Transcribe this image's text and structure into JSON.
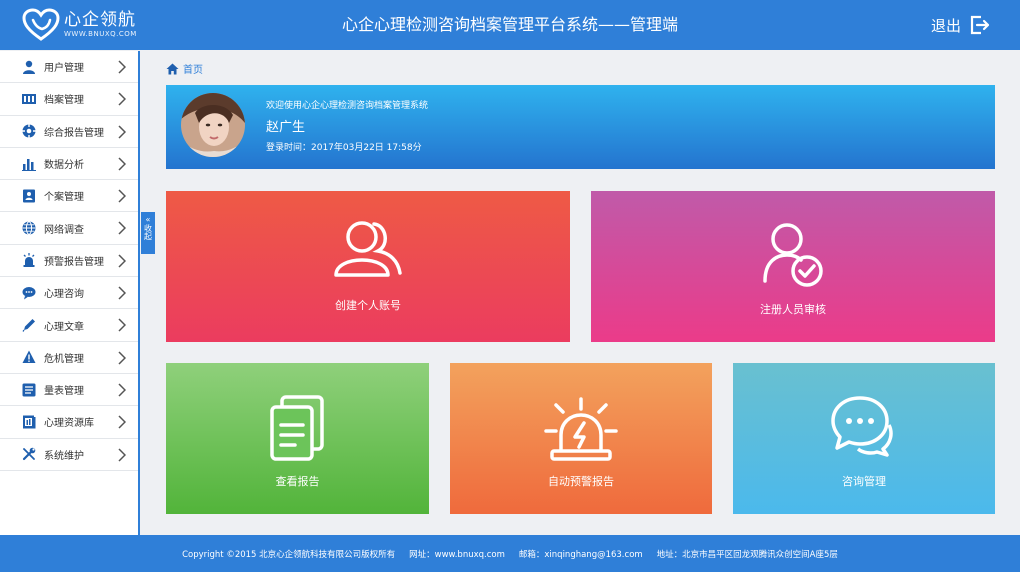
{
  "header": {
    "brand_name": "心企领航",
    "brand_url": "WWW.BNUXQ.COM",
    "title": "心企心理检测咨询档案管理平台系统——管理端",
    "logout_label": "退出"
  },
  "sidebar": {
    "items": [
      {
        "label": "用户管理",
        "icon": "user-icon"
      },
      {
        "label": "档案管理",
        "icon": "archive-icon"
      },
      {
        "label": "综合报告管理",
        "icon": "compass-icon"
      },
      {
        "label": "数据分析",
        "icon": "bar-chart-icon"
      },
      {
        "label": "个案管理",
        "icon": "contact-card-icon"
      },
      {
        "label": "网络调查",
        "icon": "globe-icon"
      },
      {
        "label": "预警报告管理",
        "icon": "alarm-light-icon"
      },
      {
        "label": "心理咨询",
        "icon": "chat-icon"
      },
      {
        "label": "心理文章",
        "icon": "pencil-icon"
      },
      {
        "label": "危机管理",
        "icon": "warning-icon"
      },
      {
        "label": "量表管理",
        "icon": "list-icon"
      },
      {
        "label": "心理资源库",
        "icon": "resource-icon"
      },
      {
        "label": "系统维护",
        "icon": "tools-icon"
      }
    ],
    "collapse_label": "收起"
  },
  "breadcrumb": {
    "home_label": "首页"
  },
  "welcome": {
    "greeting": "欢迎使用心企心理检测咨询档案管理系统",
    "user_name": "赵广生",
    "login_time": "登录时间：2017年03月22日 17:58分"
  },
  "tiles": {
    "create_account": "创建个人账号",
    "review_registrations": "注册人员审核",
    "view_reports": "查看报告",
    "auto_alert_reports": "自动预警报告",
    "consultation_management": "咨询管理"
  },
  "footer": {
    "copyright": "Copyright ©2015 北京心企领航科技有限公司版权所有",
    "website": "网址：www.bnuxq.com",
    "email": "邮箱：xinqinghang@163.com",
    "address": "地址：北京市昌平区回龙观腾讯众创空间A座5层"
  },
  "colors": {
    "primary": "#2f7fd8",
    "tile_create": "#ec4b52",
    "tile_review": "#d64a99",
    "tile_reports": "#6cc45a",
    "tile_alerts": "#f18a4d",
    "tile_consult": "#5bbddd"
  }
}
